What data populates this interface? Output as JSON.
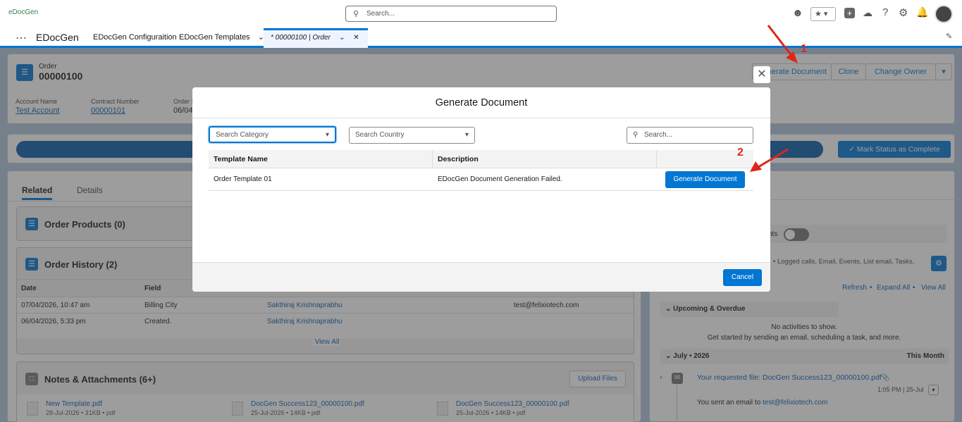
{
  "global": {
    "logo": "eDocGen",
    "search_placeholder": "Search..."
  },
  "appbar": {
    "app_name": "EDocGen",
    "tabs": [
      {
        "label": "EDocGen Configuraition"
      },
      {
        "label": "EDocGen Templates"
      },
      {
        "label": "* 00000100 | Order"
      }
    ]
  },
  "record": {
    "object": "Order",
    "number": "00000100",
    "actions": [
      "Generate Document",
      "Clone",
      "Change Owner"
    ],
    "fields": [
      {
        "label": "Account Name",
        "value": "Test Account"
      },
      {
        "label": "Contract Number",
        "value": "00000101"
      },
      {
        "label": "Order S",
        "value": "06/04"
      }
    ]
  },
  "path": {
    "mark_complete": "Mark Status as Complete"
  },
  "left": {
    "tabs": [
      "Related",
      "Details"
    ],
    "order_products": "Order Products (0)",
    "order_history": {
      "title": "Order History (2)",
      "headers": [
        "Date",
        "Field"
      ],
      "rows": [
        {
          "date": "07/04/2026, 10:47 am",
          "field": "Billing City",
          "user": "Sakthiraj Krishnaprabhu",
          "value": "test@felixiotech.com"
        },
        {
          "date": "06/04/2026, 5:33 pm",
          "field": "Created.",
          "user": "Sakthiraj Krishnaprabhu",
          "value": ""
        }
      ],
      "view_all": "View All"
    },
    "notes": {
      "title": "Notes & Attachments (6+)",
      "upload": "Upload Files",
      "files": [
        {
          "name": "New Template.pdf",
          "meta": "28-Jul-2026 • 31KB • pdf"
        },
        {
          "name": "DocGen Success123_00000100.pdf",
          "meta": "25-Jul-2026 • 14KB • pdf"
        },
        {
          "name": "DocGen Success123_00000100.pdf",
          "meta": "25-Jul-2026 • 14KB • pdf"
        }
      ]
    }
  },
  "right": {
    "toggle_label": "nts",
    "filters": "• Logged calls, Email, Events, List email, Tasks,",
    "links": [
      "Refresh",
      "Expand All",
      "View All"
    ],
    "upcoming": "Upcoming & Overdue",
    "no_activity": "No activities to show.",
    "no_activity_hint": "Get started by sending an email, scheduling a task, and more.",
    "month": "July • 2026",
    "this_month": "This Month",
    "activity": {
      "title": "Your requested file: DocGen Success123_00000100.pdf",
      "time": "1:05 PM | 25-Jul",
      "body_prefix": "You sent an email to ",
      "email": "test@felixiotech.com"
    }
  },
  "modal": {
    "title": "Generate Document",
    "category_placeholder": "Search Category",
    "country_placeholder": "Search Country",
    "search_placeholder": "Search...",
    "headers": [
      "Template Name",
      "Description"
    ],
    "rows": [
      {
        "name": "Order Template 01",
        "description": "EDocGen Document Generation Failed.",
        "action": "Generate Document"
      }
    ],
    "cancel": "Cancel"
  },
  "annotations": {
    "one": "1",
    "two": "2"
  },
  "colors": {
    "brand": "#0176d3",
    "arrow": "#e0251b"
  }
}
